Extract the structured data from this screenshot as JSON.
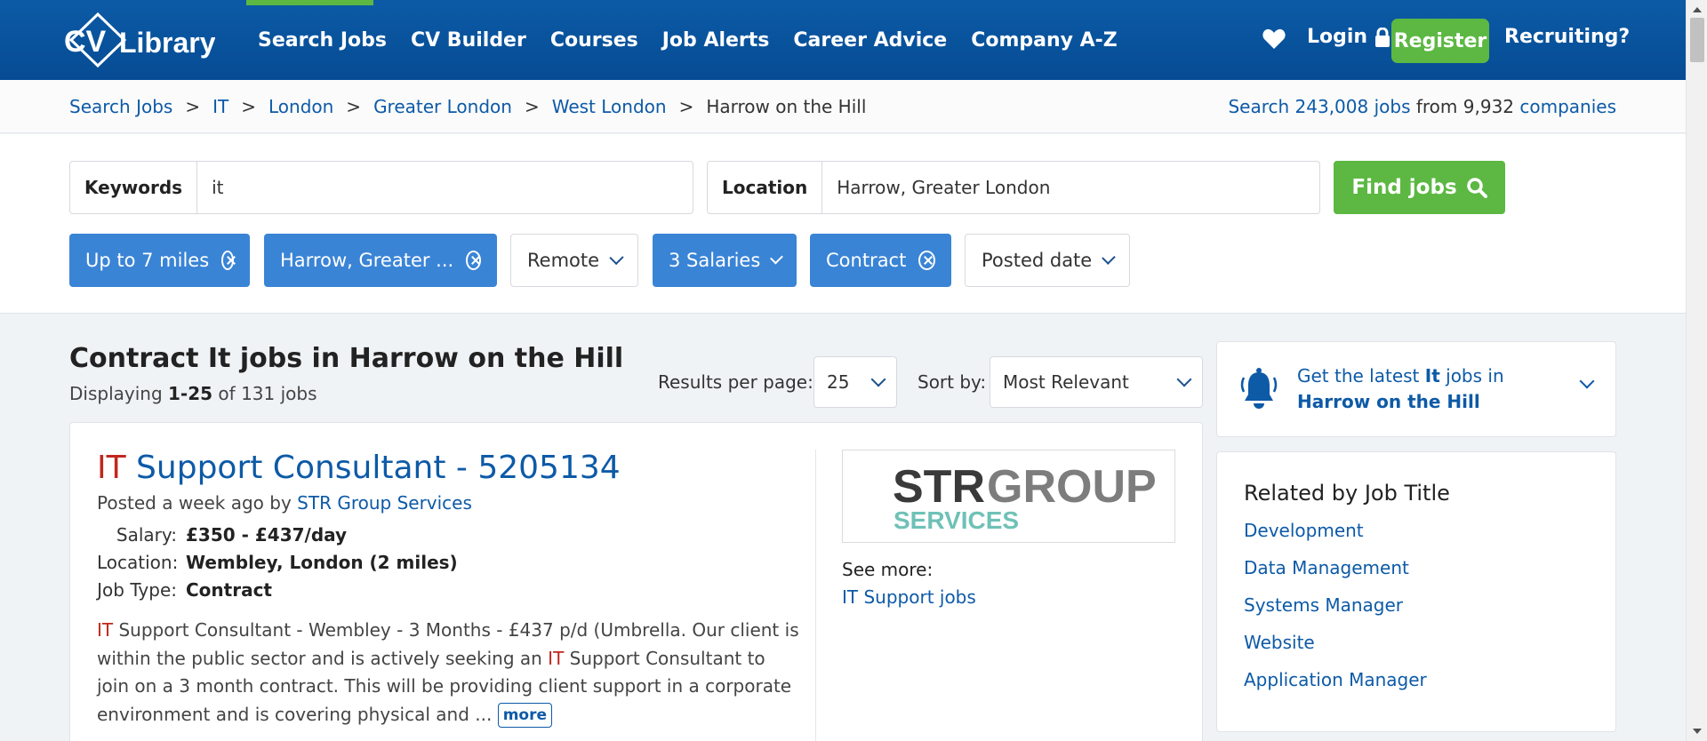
{
  "nav": {
    "logo_text": "CV Library",
    "items": [
      "Search Jobs",
      "CV Builder",
      "Courses",
      "Job Alerts",
      "Career Advice",
      "Company A-Z"
    ],
    "login": "Login",
    "register": "Register",
    "recruiting": "Recruiting?",
    "accent_color": "#5cb842",
    "brand_color": "#0c5aa6"
  },
  "breadcrumb": {
    "links": [
      "Search Jobs",
      "IT",
      "London",
      "Greater London",
      "West London"
    ],
    "current": "Harrow on the Hill",
    "separator": ">"
  },
  "stats": {
    "prefix": "Search ",
    "jobs": "243,008 jobs",
    "middle": " from 9,932 ",
    "companies": "companies"
  },
  "search": {
    "keywords_label": "Keywords",
    "keywords_value": "it",
    "location_label": "Location",
    "location_value": "Harrow, Greater London",
    "find_button": "Find jobs"
  },
  "filters": {
    "distance": "Up to 7 miles",
    "location": "Harrow, Greater ...",
    "remote": "Remote",
    "salaries": "3 Salaries",
    "contract": "Contract",
    "posted": "Posted date"
  },
  "results": {
    "title": "Contract It jobs in Harrow on the Hill",
    "displaying_prefix": "Displaying ",
    "range": "1-25",
    "displaying_suffix": " of 131 jobs",
    "per_page_label": "Results per page:",
    "per_page_value": "25",
    "sort_label": "Sort by:",
    "sort_value": "Most Relevant"
  },
  "job": {
    "title_highlight": "IT",
    "title_rest": " Support Consultant - 5205134",
    "posted_prefix": "Posted a week ago by ",
    "company": "STR Group Services",
    "salary_label": "Salary:",
    "salary": "£350 - £437/day",
    "location_label": "Location:",
    "location": "Wembley, London (2 miles)",
    "type_label": "Job Type:",
    "type": "Contract",
    "desc_1": "IT",
    "desc_2": " Support Consultant - Wembley - 3 Months - £437 p/d (Umbrella. Our client is within the public sector and is actively seeking an ",
    "desc_3": "IT",
    "desc_4": " Support Consultant to join on a 3 month contract. This will be providing client support in a corporate environment and is covering physical and ...",
    "more": "more",
    "logo_line1_a": "STR",
    "logo_line1_b": "GROUP",
    "logo_line2": "SERVICES",
    "see_more": "See more:",
    "see_more_link": "IT Support jobs"
  },
  "alert": {
    "prefix": "Get the latest ",
    "keyword": "It",
    "suffix": " jobs in",
    "location": "Harrow on the Hill"
  },
  "related": {
    "heading": "Related by Job Title",
    "items": [
      "Development",
      "Data Management",
      "Systems Manager",
      "Website",
      "Application Manager"
    ]
  }
}
